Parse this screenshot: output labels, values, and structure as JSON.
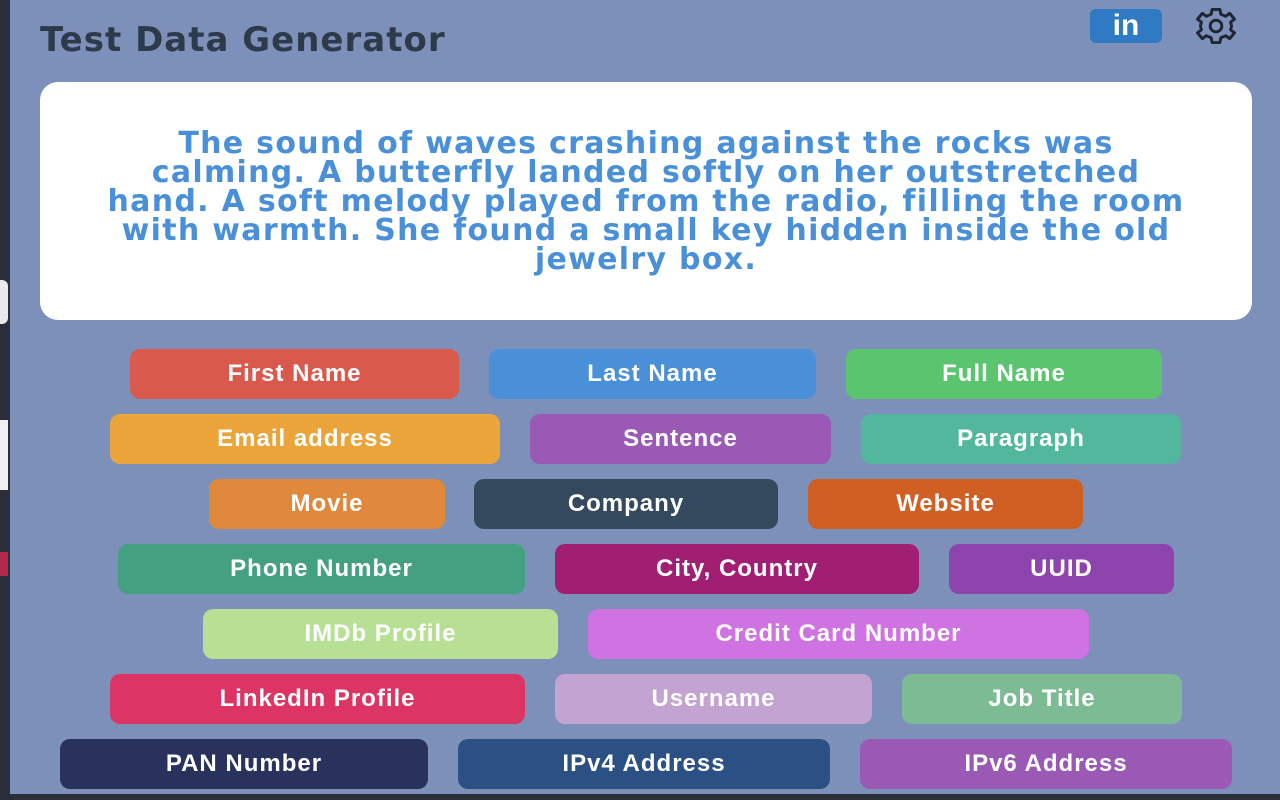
{
  "header": {
    "title": "Test Data Generator",
    "linkedin_label": "in",
    "linkedin_icon": "linkedin-icon",
    "settings_icon": "gear-icon"
  },
  "output": {
    "text": "The sound of waves crashing against the rocks was calming. A butterfly landed softly on her outstretched hand. A soft melody played from the radio, filling the room with warmth. She found a small key hidden inside the old jewelry box."
  },
  "buttons": [
    {
      "label": "First Name",
      "color": "#d9594c"
    },
    {
      "label": "Last Name",
      "color": "#4a90d9"
    },
    {
      "label": "Full Name",
      "color": "#5ac46f"
    },
    {
      "label": "Email address",
      "color": "#eba43a"
    },
    {
      "label": "Sentence",
      "color": "#9b59b6"
    },
    {
      "label": "Paragraph",
      "color": "#52b79c"
    },
    {
      "label": "Movie",
      "color": "#e0883c"
    },
    {
      "label": "Company",
      "color": "#34495e"
    },
    {
      "label": "Website",
      "color": "#cf5f23"
    },
    {
      "label": "Phone Number",
      "color": "#43a081"
    },
    {
      "label": "City, Country",
      "color": "#a01f73"
    },
    {
      "label": "UUID",
      "color": "#8e44ad"
    },
    {
      "label": "IMDb Profile",
      "color": "#b8e094"
    },
    {
      "label": "Credit Card Number",
      "color": "#cf73e3"
    },
    {
      "label": "LinkedIn Profile",
      "color": "#dd3563"
    },
    {
      "label": "Username",
      "color": "#c3a3d1"
    },
    {
      "label": "Job Title",
      "color": "#7dbb95"
    },
    {
      "label": "PAN Number",
      "color": "#28325c"
    },
    {
      "label": "IPv4 Address",
      "color": "#2b5083"
    },
    {
      "label": "IPv6 Address",
      "color": "#9b59b6"
    }
  ]
}
